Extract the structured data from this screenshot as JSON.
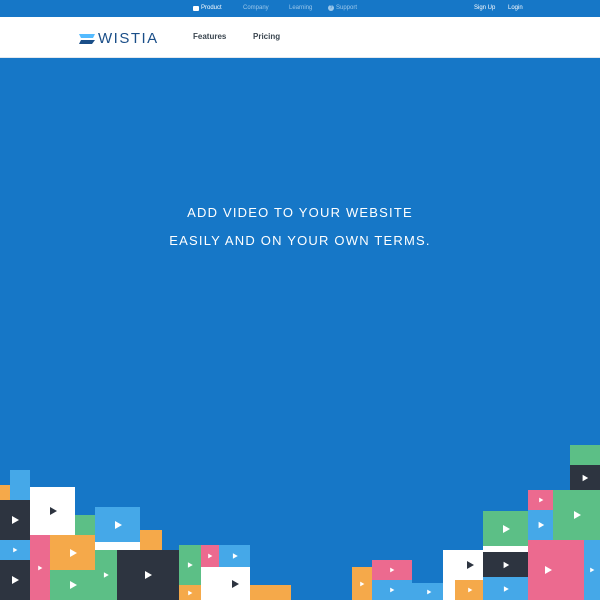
{
  "topbar": {
    "product": "Product",
    "company": "Company",
    "learning": "Learning",
    "support": "Support",
    "signup": "Sign Up",
    "login": "Login"
  },
  "header": {
    "logo_text": "WISTIA",
    "nav": [
      "Features",
      "Pricing"
    ]
  },
  "hero": {
    "line1": "ADD VIDEO TO YOUR WEBSITE",
    "line2": "EASILY AND ON YOUR OWN TERMS."
  },
  "colors": {
    "background": "#1677c7",
    "navy": "#2d3440",
    "pink": "#ec6a8f",
    "green": "#5cbf86",
    "orange": "#f5a94a",
    "lightblue": "#45a8e8",
    "white": "#ffffff"
  },
  "icons": [
    "chat-icon",
    "question-icon",
    "wistia-logo-icon",
    "play-icon"
  ]
}
